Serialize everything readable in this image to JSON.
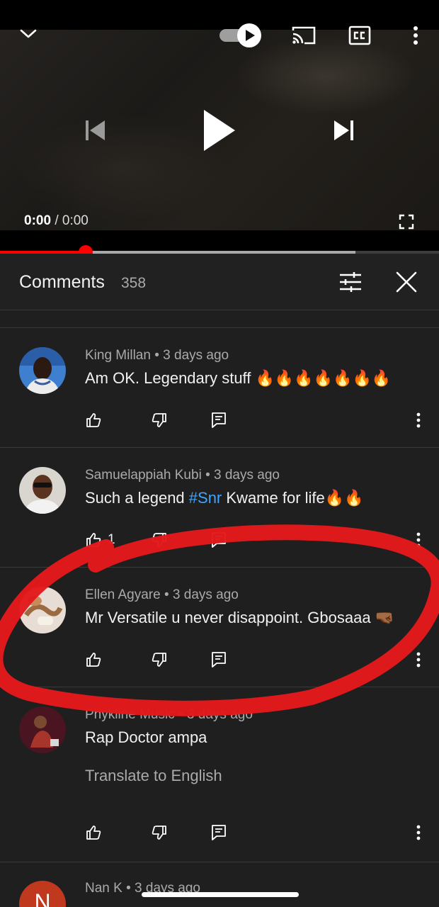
{
  "player": {
    "time_current": "0:00",
    "time_separator": "/",
    "time_duration": "0:00",
    "progress_played_fraction": 0.195,
    "progress_buffered_fraction": 0.81,
    "autoplay_on": true
  },
  "comments_panel": {
    "title": "Comments",
    "count": "358"
  },
  "comments": [
    {
      "author": "King Millan",
      "age": "3 days ago",
      "text": "Am OK. Legendary stuff 🔥🔥🔥🔥🔥🔥🔥"
    },
    {
      "author": "Samuelappiah Kubi",
      "age": "3 days ago",
      "text_before": "Such a legend ",
      "hashtag": "#Snr",
      "text_after": " Kwame for life🔥🔥",
      "likes": "1"
    },
    {
      "author": "Ellen Agyare",
      "age": "3 days ago",
      "text": "Mr Versatile u never disappoint. Gbosaaa 🤜🏾"
    },
    {
      "author": "Phykline Music",
      "age": "3 days ago",
      "text": "Rap Doctor ampa",
      "translate_label": "Translate to English"
    },
    {
      "author": "Nan K",
      "age": "3 days ago",
      "avatar_letter": "N"
    }
  ],
  "colors": {
    "accent": "#ff0000",
    "background": "#1f1f1f",
    "hashtag": "#3ea6ff",
    "annotation": "#e3191c"
  },
  "icons": {
    "player": [
      "chevron-down-icon",
      "autoplay-toggle-icon",
      "cast-icon",
      "captions-icon",
      "more-vert-icon",
      "previous-icon",
      "play-icon",
      "next-icon",
      "fullscreen-icon"
    ],
    "header": [
      "sort-filter-icon",
      "close-icon"
    ],
    "comment_actions": [
      "thumbs-up-icon",
      "thumbs-down-icon",
      "reply-icon",
      "more-vert-icon"
    ]
  }
}
